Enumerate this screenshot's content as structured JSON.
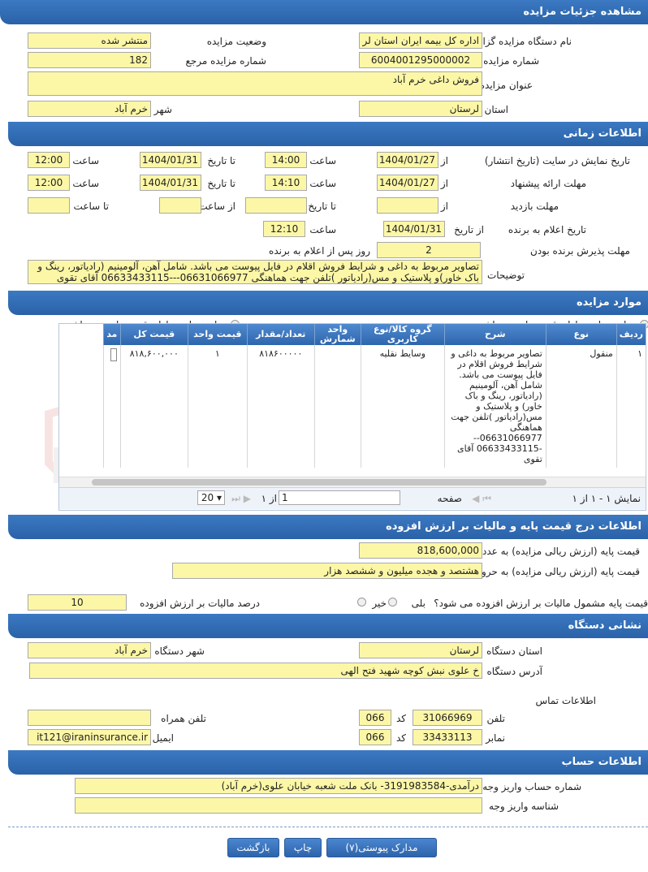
{
  "sections": {
    "details": "مشاهده جزئیات مزایده",
    "time": "اطلاعات زمانی",
    "items": "موارد مزایده",
    "price": "اطلاعات درج قیمت پایه و مالیات بر ارزش افزوده",
    "address": "نشانی دستگاه",
    "account": "اطلاعات حساب"
  },
  "details": {
    "org_label": "نام دستگاه مزایده گزار",
    "org_value": "اداره کل بیمه ایران استان لر",
    "status_label": "وضعیت مزایده",
    "status_value": "منتشر شده",
    "number_label": "شماره مزایده",
    "number_value": "6004001295000002",
    "ref_label": "شماره مزایده مرجع",
    "ref_value": "182",
    "title_label": "عنوان مزایده",
    "title_value": "فروش داغی خرم آباد",
    "province_label": "استان",
    "province_value": "لرستان",
    "city_label": "شهر",
    "city_value": "خرم آباد"
  },
  "time": {
    "from": "از تاریخ",
    "to": "تا تاریخ",
    "hour": "ساعت",
    "to_hour": "تا ساعت",
    "from_hour": "از ساعت",
    "display_label": "تاریخ نمایش در سایت (تاریخ انتشار)",
    "display_from": "1404/01/27",
    "display_from_time": "14:00",
    "display_to": "1404/01/31",
    "display_to_time": "12:00",
    "offer_label": "مهلت ارائه پیشنهاد",
    "offer_from": "1404/01/27",
    "offer_from_time": "14:10",
    "offer_to": "1404/01/31",
    "offer_to_time": "12:00",
    "visit_label": "مهلت بازدید",
    "winner_label": "تاریخ اعلام به برنده",
    "winner_date": "1404/01/31",
    "winner_time": "12:10",
    "accept_label": "مهلت پذیرش برنده بودن",
    "accept_value": "2",
    "accept_suffix": "روز پس از اعلام به برنده",
    "desc_label": "توضیحات",
    "desc_value": "تصاویر مربوط به داغی و شرایط فروش اقلام در فایل پیوست می باشد. شامل آهن، آلومینیم (رادیاتور، رینگ و باک خاور)و پلاستیک و مس(رادیاتور )تلفن جهت هماهنگی 06631066977---06633433115 آقای تقوی"
  },
  "items": {
    "has_base": "موارد مزایده دارای قیمت پایه می باشند",
    "no_base": "موارد مزایده دارای قیمت پایه نمی باشند",
    "columns": [
      "ردیف",
      "نوع",
      "شرح",
      "گروه کالا/نوع کاربری",
      "واحد شمارش",
      "تعداد/مقدار",
      "قیمت واحد",
      "قیمت کل",
      "مد"
    ],
    "row": {
      "index": "۱",
      "type": "منقول",
      "desc": "تصاویر مربوط به داغی و شرایط فروش اقلام در فایل پیوست می باشد. شامل آهن، آلومینیم (رادیاتور، رینگ و باک خاور) و پلاستیک و مس(رادیاتور )تلفن جهت هماهنگی 06631066977-- -06633433115 آقای تقوی",
      "group": "وسایط نقلیه",
      "unit": "",
      "qty": "۸۱۸۶۰۰۰۰۰",
      "unit_price": "۱",
      "total": "۸۱۸,۶۰۰,۰۰۰"
    },
    "pager": {
      "summary": "نمایش ۱ - ۱ از ۱",
      "page_label": "صفحه",
      "page_value": "1",
      "of_label": "از ۱",
      "page_size": "20"
    }
  },
  "price": {
    "num_label": "قیمت پایه (ارزش ریالی مزایده) به عدد",
    "num_value": "818,600,000",
    "word_label": "قیمت پایه (ارزش ریالی مزایده) به حروف",
    "word_value": "هشتصد و هجده میلیون و ششصد هزار",
    "vat_q": "قیمت پایه مشمول مالیات بر ارزش افزوده می شود؟",
    "yes": "بلی",
    "no": "خیر",
    "vat_pct_label": "درصد مالیات بر ارزش افزوده",
    "vat_pct_value": "10"
  },
  "address": {
    "province_label": "استان دستگاه",
    "province_value": "لرستان",
    "city_label": "شهر دستگاه",
    "city_value": "خرم آباد",
    "addr_label": "آدرس دستگاه",
    "addr_value": "خ علوی نبش کوچه شهید فتح الهی",
    "contact_label": "اطلاعات تماس",
    "phone_label": "تلفن",
    "phone_value": "31066969",
    "code_label": "کد",
    "phone_code": "066",
    "mobile_label": "تلفن همراه",
    "fax_label": "نمابر",
    "fax_value": "33433113",
    "fax_code": "066",
    "email_label": "ایمیل",
    "email_value": "it121@iraninsurance.ir"
  },
  "account": {
    "acc_label": "شماره حساب واریز وجه",
    "acc_value": "درآمدی-3191983584- بانک ملت شعبه خیابان علوی(خرم آباد)",
    "id_label": "شناسه واریز وجه"
  },
  "buttons": {
    "docs": "مدارک پیوستی(۷)",
    "print": "چاپ",
    "back": "بازگشت"
  },
  "watermark": "AriaTender.net"
}
